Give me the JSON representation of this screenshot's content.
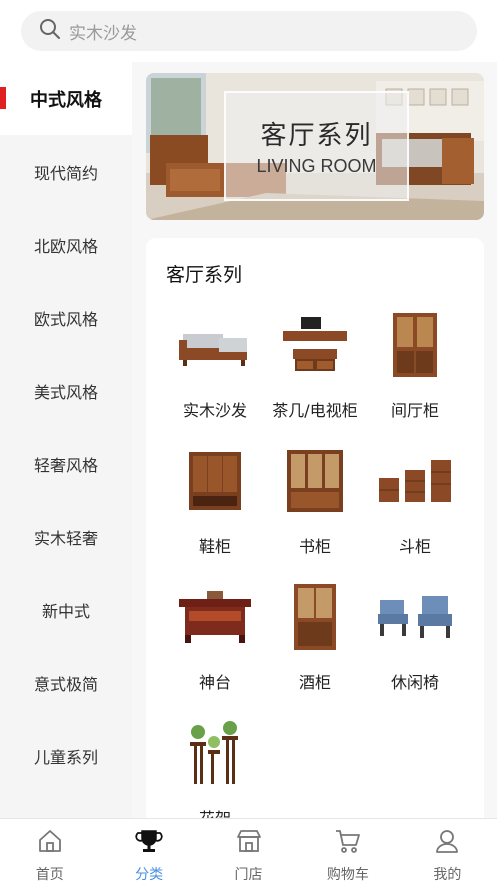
{
  "search": {
    "placeholder": "实木沙发"
  },
  "sidebar": {
    "items": [
      {
        "label": "中式风格",
        "active": true
      },
      {
        "label": "现代简约",
        "active": false
      },
      {
        "label": "北欧风格",
        "active": false
      },
      {
        "label": "欧式风格",
        "active": false
      },
      {
        "label": "美式风格",
        "active": false
      },
      {
        "label": "轻奢风格",
        "active": false
      },
      {
        "label": "实木轻奢",
        "active": false
      },
      {
        "label": "新中式",
        "active": false
      },
      {
        "label": "意式极简",
        "active": false
      },
      {
        "label": "儿童系列",
        "active": false
      }
    ]
  },
  "banner": {
    "title": "客厅系列",
    "subtitle": "LIVING ROOM"
  },
  "section": {
    "title": "客厅系列",
    "products": [
      {
        "label": "实木沙发",
        "icon": "sofa-icon"
      },
      {
        "label": "茶几/电视柜",
        "icon": "tv-cabinet-icon"
      },
      {
        "label": "间厅柜",
        "icon": "partition-cabinet-icon"
      },
      {
        "label": "鞋柜",
        "icon": "shoe-cabinet-icon"
      },
      {
        "label": "书柜",
        "icon": "bookcase-icon"
      },
      {
        "label": "斗柜",
        "icon": "chest-icon"
      },
      {
        "label": "神台",
        "icon": "altar-icon"
      },
      {
        "label": "酒柜",
        "icon": "wine-cabinet-icon"
      },
      {
        "label": "休闲椅",
        "icon": "lounge-chair-icon"
      },
      {
        "label": "花架",
        "icon": "flower-stand-icon"
      }
    ]
  },
  "tabbar": {
    "tabs": [
      {
        "label": "首页",
        "icon": "home-icon",
        "active": false
      },
      {
        "label": "分类",
        "icon": "trophy-icon",
        "active": true
      },
      {
        "label": "门店",
        "icon": "store-icon",
        "active": false
      },
      {
        "label": "购物车",
        "icon": "cart-icon",
        "active": false
      },
      {
        "label": "我的",
        "icon": "user-icon",
        "active": false
      }
    ]
  },
  "colors": {
    "accent": "#e02020",
    "active_tab": "#4a90e2",
    "wood": "#8b4a25"
  }
}
